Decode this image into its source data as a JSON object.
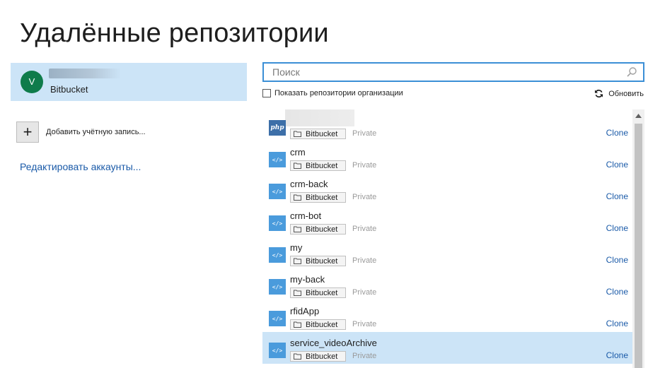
{
  "page": {
    "title": "Удалённые репозитории"
  },
  "account": {
    "avatar_letter": "V",
    "avatar_color": "#0f7c4b",
    "service": "Bitbucket"
  },
  "sidebar": {
    "add_account_label": "Добавить учётную запись...",
    "edit_accounts_label": "Редактировать аккаунты..."
  },
  "search": {
    "placeholder": "Поиск",
    "value": ""
  },
  "filters": {
    "show_org_label": "Показать репозитории организации",
    "show_org_checked": false,
    "refresh_label": "Обновить"
  },
  "repos": [
    {
      "name": "",
      "icon": "php-icon",
      "provider": "Bitbucket",
      "visibility": "Private",
      "action": "Clone",
      "selected": false
    },
    {
      "name": "crm",
      "icon": "code-icon",
      "provider": "Bitbucket",
      "visibility": "Private",
      "action": "Clone",
      "selected": false
    },
    {
      "name": "crm-back",
      "icon": "code-icon",
      "provider": "Bitbucket",
      "visibility": "Private",
      "action": "Clone",
      "selected": false
    },
    {
      "name": "crm-bot",
      "icon": "code-icon",
      "provider": "Bitbucket",
      "visibility": "Private",
      "action": "Clone",
      "selected": false
    },
    {
      "name": "my",
      "icon": "code-icon",
      "provider": "Bitbucket",
      "visibility": "Private",
      "action": "Clone",
      "selected": false
    },
    {
      "name": "my-back",
      "icon": "code-icon",
      "provider": "Bitbucket",
      "visibility": "Private",
      "action": "Clone",
      "selected": false
    },
    {
      "name": "rfidApp",
      "icon": "code-icon",
      "provider": "Bitbucket",
      "visibility": "Private",
      "action": "Clone",
      "selected": false
    },
    {
      "name": "service_videoArchive",
      "icon": "code-icon",
      "provider": "Bitbucket",
      "visibility": "Private",
      "action": "Clone",
      "selected": true
    }
  ],
  "colors": {
    "accent": "#3b8fd6",
    "selection": "#cce4f7",
    "link": "#1a5aa8",
    "repo_icon": "#4a9bdc"
  }
}
